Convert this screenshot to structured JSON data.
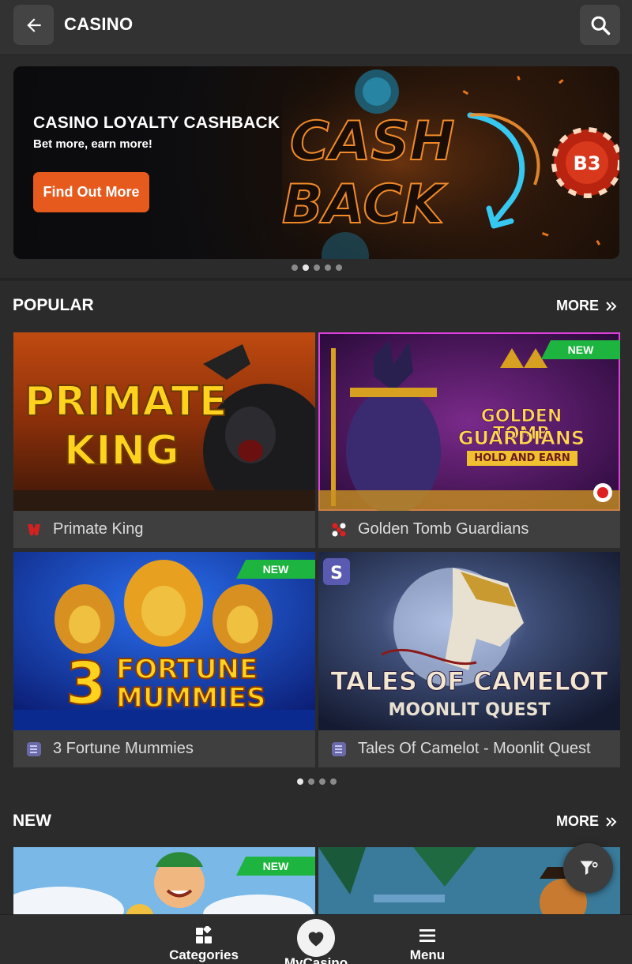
{
  "header": {
    "title": "CASINO",
    "back_icon": "arrow-left-icon",
    "search_icon": "search-icon"
  },
  "banner": {
    "title": "CASINO LOYALTY CASHBACK",
    "subtitle": "Bet more, earn more!",
    "cta_label": "Find Out More",
    "art_line1": "CASH",
    "art_line2": "BACK",
    "chip_logo": "B3",
    "accent": "#e65a1e",
    "slides_total": 5,
    "active_slide": 2
  },
  "popular": {
    "title": "POPULAR",
    "more_label": "MORE",
    "games": [
      {
        "name": "Primate King",
        "art_line1": "PRIMATE",
        "art_line2": "KING",
        "new": false,
        "badge": ""
      },
      {
        "name": "Golden Tomb Guardians",
        "art_line1": "GOLDEN TOMB",
        "art_line2": "GUARDIANS",
        "art_line3": "HOLD AND EARN",
        "new": true,
        "badge": "NEW"
      },
      {
        "name": "3 Fortune Mummies",
        "art_line1": "FORTUNE",
        "art_line2": "MUMMIES",
        "art_num": "3",
        "new": true,
        "badge": "NEW"
      },
      {
        "name": "Tales Of Camelot - Moonlit Quest",
        "art_line1": "TALES OF CAMELOT",
        "art_line2": "MOONLIT QUEST",
        "new": false,
        "badge": ""
      }
    ],
    "pages_total": 4,
    "active_page": 1
  },
  "new_section": {
    "title": "NEW",
    "more_label": "MORE",
    "badge": "NEW"
  },
  "bottom_nav": {
    "categories": "Categories",
    "mycasino": "MyCasino",
    "menu": "Menu"
  }
}
